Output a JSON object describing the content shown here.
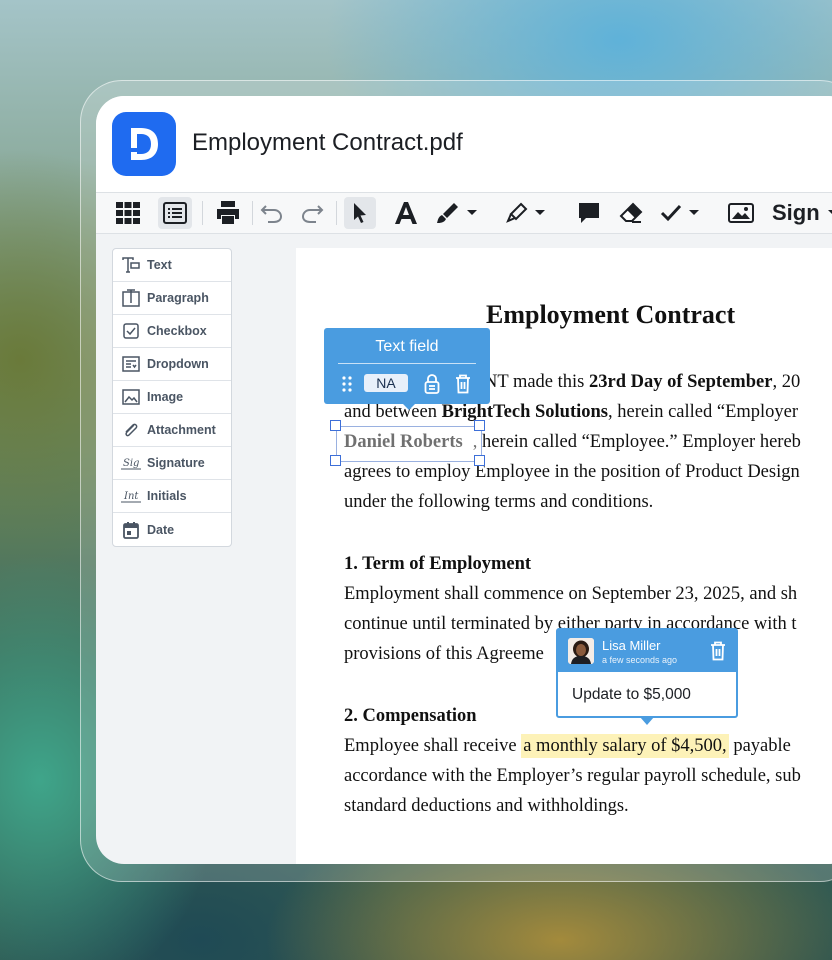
{
  "app": {
    "title": "Employment Contract.pdf",
    "brand_color": "#1f6bf0"
  },
  "toolbar": {
    "tools": [
      "grid-view",
      "list-view",
      "print",
      "undo",
      "redo",
      "select",
      "text",
      "draw",
      "highlight",
      "comment",
      "eraser",
      "checkmark",
      "image"
    ],
    "sign_label": "Sign"
  },
  "fields": {
    "items": [
      {
        "label": "Text",
        "icon": "text-field-icon"
      },
      {
        "label": "Paragraph",
        "icon": "paragraph-icon"
      },
      {
        "label": "Checkbox",
        "icon": "checkbox-icon"
      },
      {
        "label": "Dropdown",
        "icon": "dropdown-icon"
      },
      {
        "label": "Image",
        "icon": "image-icon"
      },
      {
        "label": "Attachment",
        "icon": "paperclip-icon"
      },
      {
        "label": "Signature",
        "icon": "signature-icon"
      },
      {
        "label": "Initials",
        "icon": "initials-icon"
      },
      {
        "label": "Date",
        "icon": "calendar-icon"
      }
    ]
  },
  "document": {
    "title": "Employment Contract",
    "p1": {
      "l1a": "NT made this ",
      "l1b": "23rd Day of September",
      "l1c": ", 20",
      "l2a": "and between ",
      "l2b": "BrightTech Solutions",
      "l2c": ", herein called “Employer",
      "field_value": "Daniel Roberts",
      "l3c": ", herein called “Employee.” Employer hereb",
      "l4": "agrees to employ Employee in the position of Product Design",
      "l5": "under the following terms and conditions."
    },
    "s1": {
      "heading": "1. Term of Employment",
      "l1": "Employment shall commence on September 23, 2025, and sh",
      "l2": "continue until terminated by either party in accordance with t",
      "l3": "provisions of this Agreeme"
    },
    "s2": {
      "heading": "2. Compensation",
      "l1a": "Employee shall receive ",
      "l1hl": "a monthly salary of  $4,500,",
      "l1c": " payable",
      "l2": "accordance with the Employer’s regular payroll schedule, sub",
      "l3": "standard deductions and withholdings."
    }
  },
  "text_field_popup": {
    "title": "Text field",
    "badge": "NA"
  },
  "comment": {
    "author": "Lisa Miller",
    "time": "a few seconds ago",
    "text": "Update to $5,000"
  }
}
